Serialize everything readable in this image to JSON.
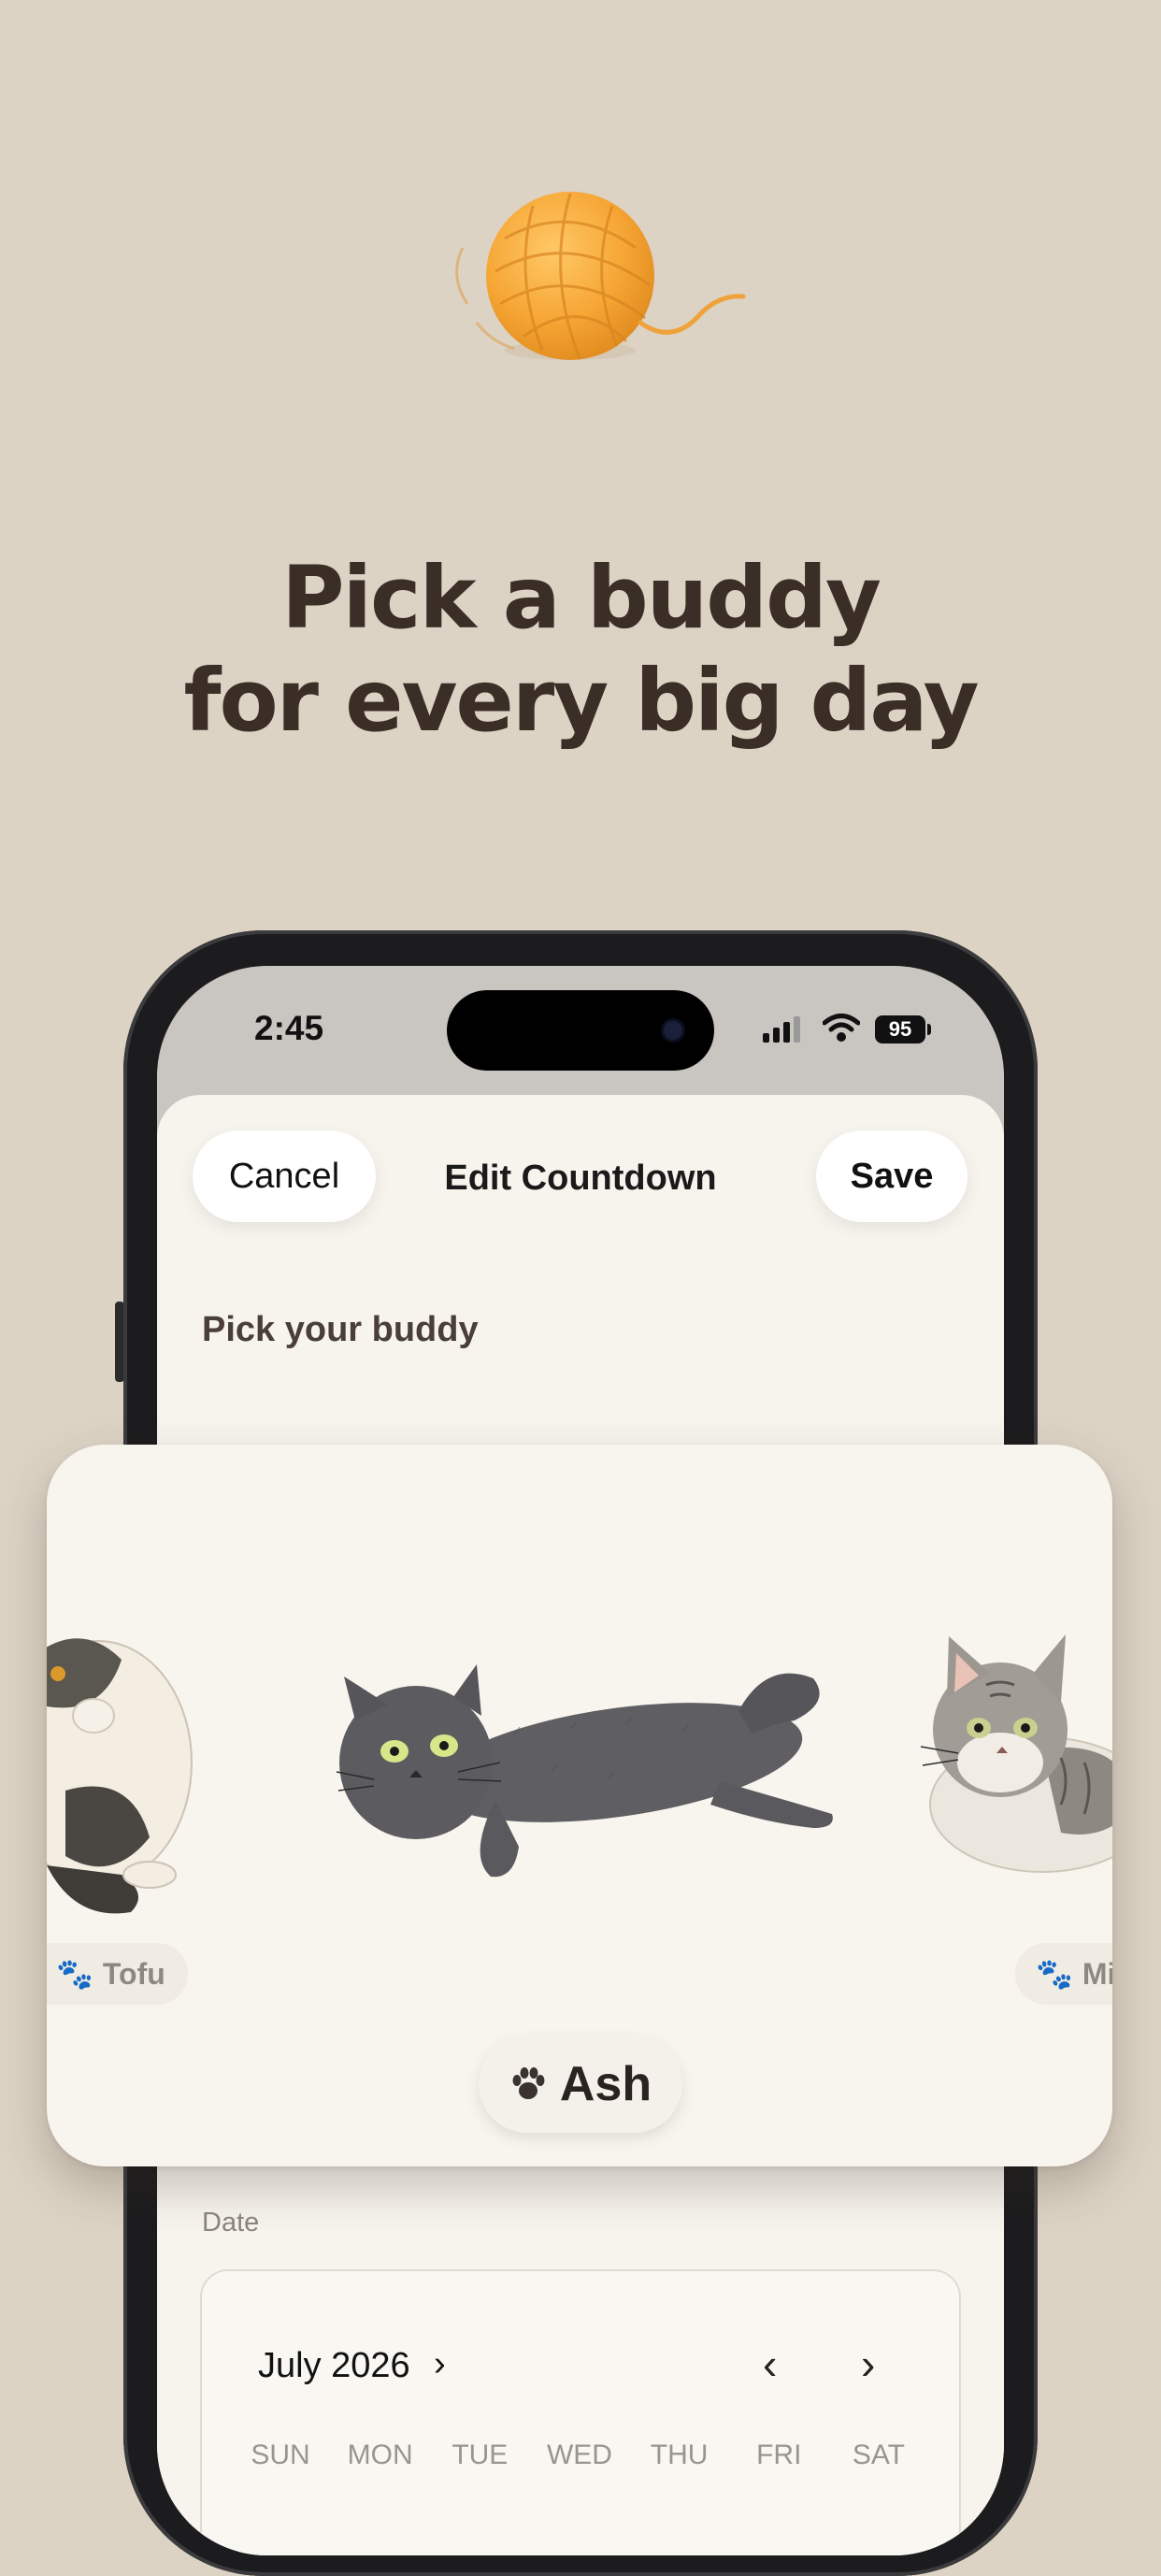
{
  "promo": {
    "headline_line1": "Pick a buddy",
    "headline_line2": "for every big day",
    "illustration": "yarn-ball-icon"
  },
  "status_bar": {
    "time": "2:45",
    "battery": "95"
  },
  "nav": {
    "cancel_label": "Cancel",
    "title": "Edit Countdown",
    "save_label": "Save"
  },
  "buddy_section": {
    "label": "Pick your buddy",
    "cats": [
      {
        "name": "Tofu"
      },
      {
        "name": "Ash",
        "selected": true
      },
      {
        "name": "Milo"
      }
    ],
    "selected_name": "Ash"
  },
  "date_section": {
    "label": "Date",
    "month": "July 2026",
    "weekdays": [
      "SUN",
      "MON",
      "TUE",
      "WED",
      "THU",
      "FRI",
      "SAT"
    ]
  },
  "colors": {
    "background": "#dcd3c5",
    "headline": "#3a2e26",
    "sheet": "#f7f4ee",
    "yarn": "#f4a83a"
  }
}
